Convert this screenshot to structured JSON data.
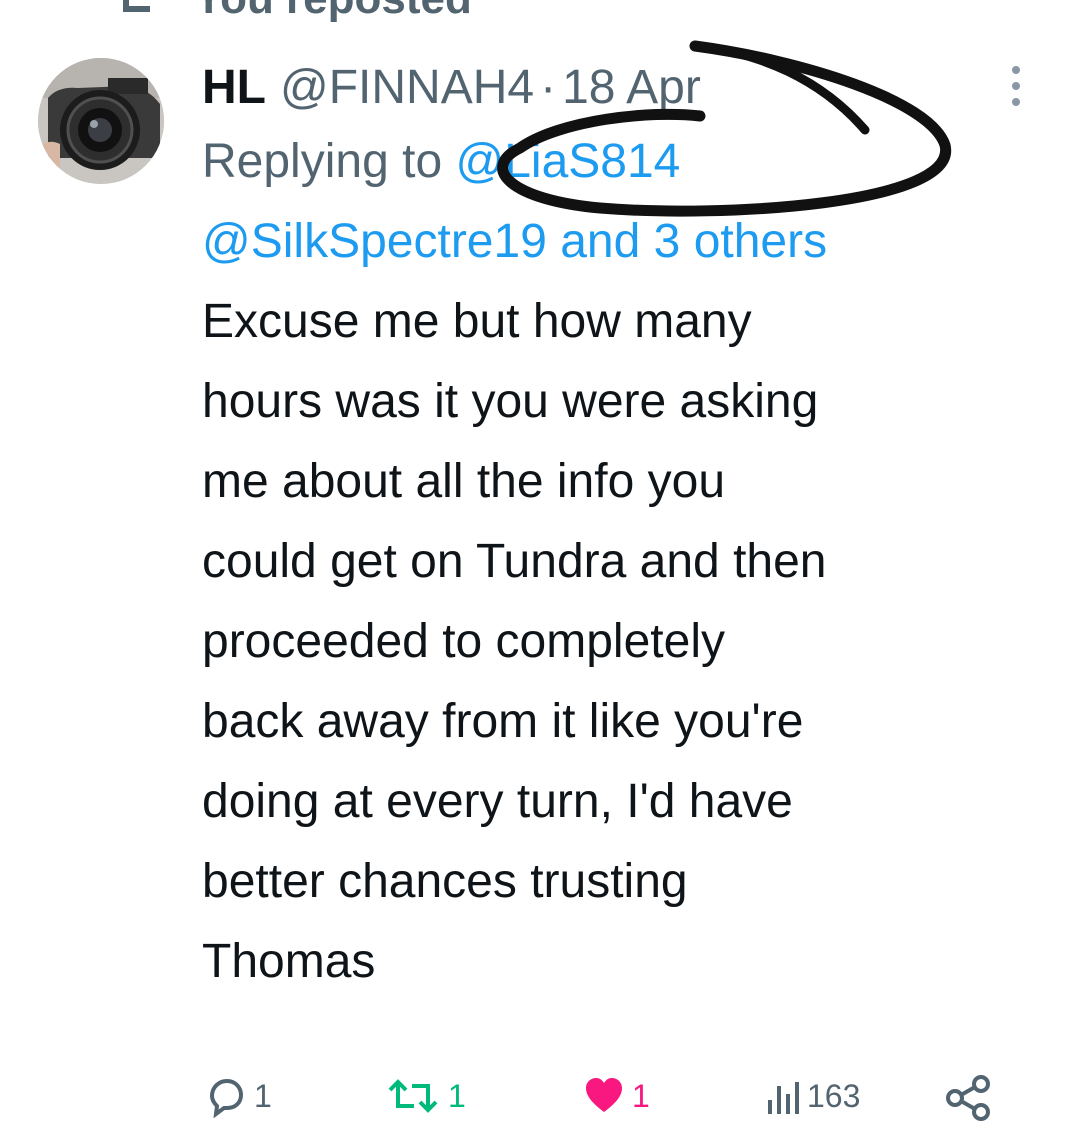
{
  "repost": {
    "label": "You reposted"
  },
  "tweet": {
    "author_name": "HL",
    "author_handle": "@FINNAH4",
    "separator": "·",
    "date": "18 Apr",
    "replying_prefix": "Replying to",
    "replying_mention": "@LiaS814",
    "replying_mention2": "@SilkSpectre19",
    "replying_and": "and",
    "replying_others": "3 others",
    "text": "Excuse me but how many\nhours was it you were asking\nme about all the info you\ncould get on Tundra and then\nproceeded to completely\nback away from it like you're\ndoing at every turn, I'd have\nbetter chances trusting\nThomas"
  },
  "actions": {
    "reply_count": "1",
    "repost_count": "1",
    "like_count": "1",
    "views_count": "163"
  },
  "colors": {
    "mention": "#1d9bf0",
    "muted": "#536471",
    "repost_active": "#00ba7c",
    "like_active": "#f91880"
  },
  "icons": [
    "repost-icon",
    "more-icon",
    "reply-icon",
    "retweet-icon",
    "heart-icon",
    "views-icon",
    "share-icon"
  ]
}
